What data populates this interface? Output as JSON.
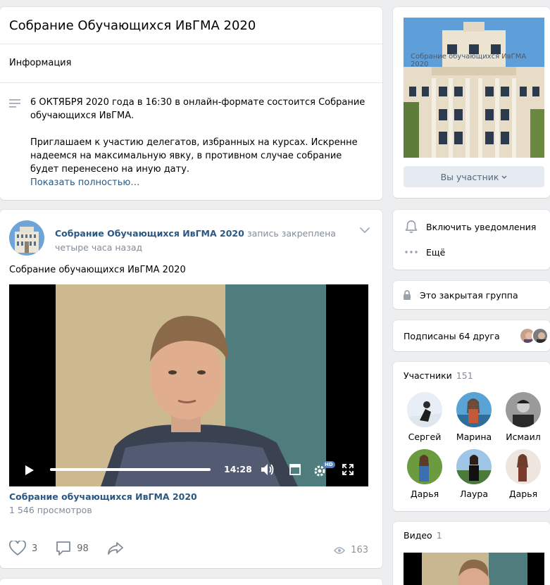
{
  "group": {
    "title": "Собрание Обучающихся ИвГМА 2020"
  },
  "info": {
    "section_label": "Информация",
    "description_p1": "6 ОКТЯБРЯ 2020 года в 16:30 в онлайн-формате состоится Собрание обучающихся ИвГМА.",
    "description_p2": "Приглашаем к участию делегатов, избранных на курсах. Искренне надеемся на максимальную явку, в противном случае собрание будет перенесено на иную дату.",
    "show_more": "Показать полностью…"
  },
  "post": {
    "author": "Собрание Обучающихся ИвГМА 2020",
    "pinned_label": "запись закреплена",
    "time": "четыре часа назад",
    "text": "Собрание обучающихся ИвГМА 2020",
    "video": {
      "duration": "14:28",
      "progress": 1.0,
      "quality_badge": "HD"
    },
    "video_title": "Собрание обучающихся ИвГМА 2020",
    "video_views": "1 546 просмотров",
    "likes": "3",
    "comments": "98",
    "views": "163"
  },
  "sidebar": {
    "cover_caption": "Собрание обучающихся ИвГМА 2020",
    "member_button": "Вы участник",
    "notifications": "Включить уведомления",
    "more": "Ещё",
    "closed_group": "Это закрытая группа",
    "friends": "Подписаны 64 друга",
    "members_label": "Участники",
    "members_count": "151",
    "members": [
      {
        "name": "Сергей"
      },
      {
        "name": "Марина"
      },
      {
        "name": "Исмаил"
      },
      {
        "name": "Дарья"
      },
      {
        "name": "Лаура"
      },
      {
        "name": "Дарья"
      }
    ],
    "videos_label": "Видео",
    "videos_count": "1"
  },
  "colors": {
    "background": "#edeef0",
    "link": "#2a5885",
    "muted": "#818c99",
    "button_bg": "#e5ebf1"
  }
}
